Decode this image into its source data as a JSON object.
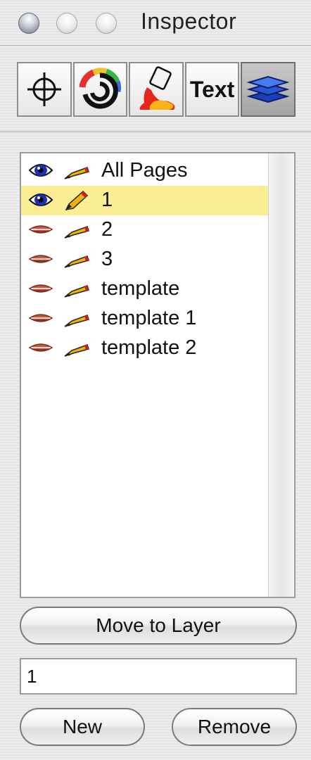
{
  "window": {
    "title": "Inspector"
  },
  "toolbar": {
    "tools": [
      {
        "icon": "crosshair-icon"
      },
      {
        "icon": "color-wheel-icon"
      },
      {
        "icon": "paint-bucket-icon"
      },
      {
        "label": "Text",
        "icon": "text-icon"
      },
      {
        "icon": "layers-icon"
      }
    ],
    "active_index": 4
  },
  "layers": [
    {
      "label": "All Pages",
      "visible": true,
      "editable": false,
      "selected": false
    },
    {
      "label": "1",
      "visible": true,
      "editable": true,
      "selected": true
    },
    {
      "label": "2",
      "visible": false,
      "editable": false,
      "selected": false
    },
    {
      "label": "3",
      "visible": false,
      "editable": false,
      "selected": false
    },
    {
      "label": "template",
      "visible": false,
      "editable": false,
      "selected": false
    },
    {
      "label": "template 1",
      "visible": false,
      "editable": false,
      "selected": false
    },
    {
      "label": "template 2",
      "visible": false,
      "editable": false,
      "selected": false
    }
  ],
  "actions": {
    "move_to_layer": "Move to Layer",
    "name_value": "1",
    "new_label": "New",
    "remove_label": "Remove"
  },
  "colors": {
    "selection": "#faed94",
    "eye_open": "#1c2fb5",
    "eye_closed": "#c4553f",
    "pencil_body": "#f0b400",
    "pencil_tip": "#d22020"
  }
}
